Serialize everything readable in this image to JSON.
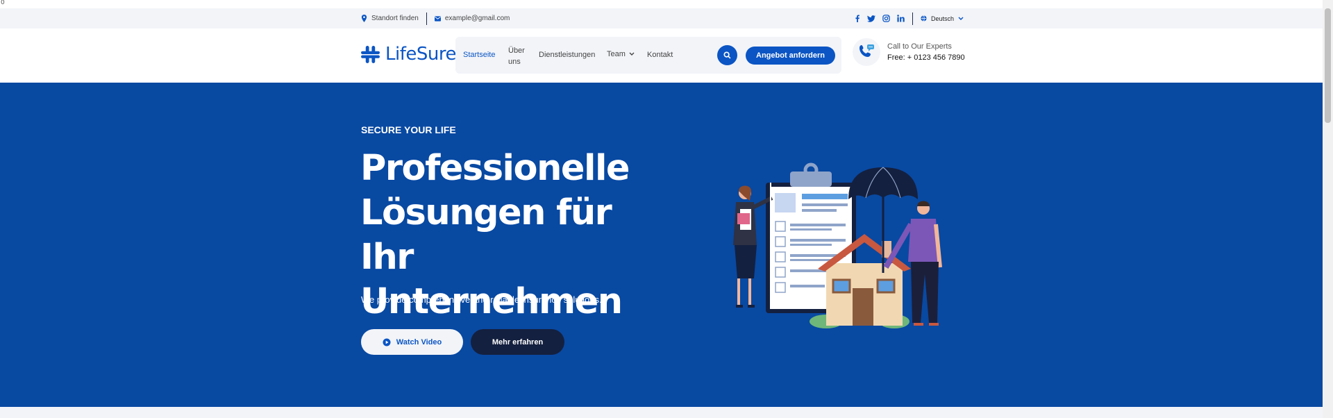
{
  "corner_mark": "0",
  "topbar": {
    "location": "Standort finden",
    "email": "example@gmail.com",
    "socials": [
      "facebook-icon",
      "twitter-icon",
      "instagram-icon",
      "linkedin-icon"
    ],
    "language": "Deutsch"
  },
  "header": {
    "logo": "LifeSure",
    "nav": [
      {
        "label": "Startseite",
        "active": true
      },
      {
        "label": "Über uns"
      },
      {
        "label": "Dienstleistungen"
      },
      {
        "label": "Team"
      },
      {
        "label": "Kontakt"
      }
    ],
    "quote_button": "Angebot anfordern",
    "call_label": "Call to Our Experts",
    "call_number": "Free: + 0123 456 7890"
  },
  "hero": {
    "eyebrow": "SECURE YOUR LIFE",
    "title": "Professionelle Lösungen für Ihr Unternehmen",
    "subtitle": "We provide comprehensive and reliable insurance solutions.",
    "watch_button": "Watch Video",
    "more_button": "Mehr erfahren"
  },
  "colors": {
    "primary": "#0b55c4",
    "hero_bg": "#0849a2",
    "dark_button": "#14203f",
    "topbar_bg": "#f2f4f8"
  }
}
